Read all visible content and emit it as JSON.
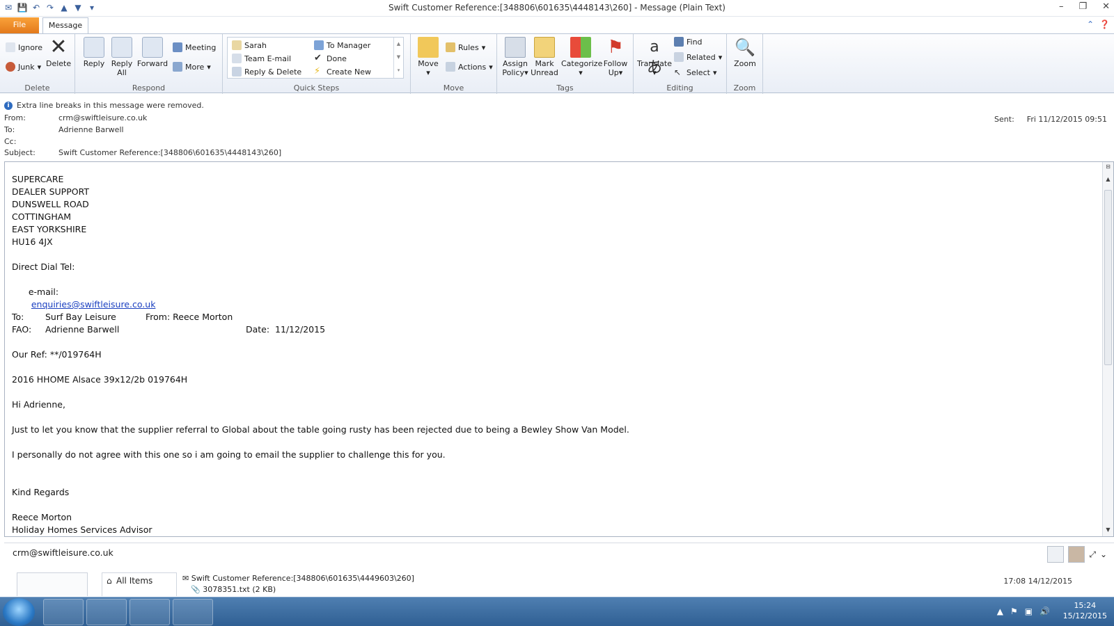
{
  "window": {
    "title": "Swift Customer Reference:[348806\\601635\\4448143\\260]  - Message (Plain Text)"
  },
  "tabs": {
    "file": "File",
    "message": "Message"
  },
  "ribbon": {
    "delete_group": {
      "label": "Delete",
      "ignore": "Ignore",
      "junk": "Junk",
      "delete": "Delete"
    },
    "respond_group": {
      "label": "Respond",
      "reply": "Reply",
      "reply_all_1": "Reply",
      "reply_all_2": "All",
      "forward": "Forward",
      "meeting": "Meeting",
      "more": "More"
    },
    "quick_steps": {
      "label": "Quick Steps",
      "sarah": "Sarah",
      "team_email": "Team E-mail",
      "reply_delete": "Reply & Delete",
      "to_manager": "To Manager",
      "done": "Done",
      "create_new": "Create New"
    },
    "move_group": {
      "label": "Move",
      "move": "Move",
      "rules": "Rules",
      "actions": "Actions"
    },
    "tags_group": {
      "label": "Tags",
      "assign_1": "Assign",
      "assign_2": "Policy",
      "mark_1": "Mark",
      "mark_2": "Unread",
      "categorize": "Categorize",
      "follow_1": "Follow",
      "follow_2": "Up"
    },
    "editing_group": {
      "label": "Editing",
      "translate": "Translate",
      "find": "Find",
      "related": "Related",
      "select": "Select"
    },
    "zoom_group": {
      "label": "Zoom",
      "zoom": "Zoom"
    }
  },
  "header": {
    "info": "Extra line breaks in this message were removed.",
    "from_label": "From:",
    "from": "crm@swiftleisure.co.uk",
    "to_label": "To:",
    "to": "Adrienne Barwell",
    "cc_label": "Cc:",
    "subject_label": "Subject:",
    "subject": "Swift Customer Reference:[348806\\601635\\4448143\\260]",
    "sent_label": "Sent:",
    "sent": "Fri 11/12/2015 09:51"
  },
  "body": {
    "l1": "SUPERCARE",
    "l2": "DEALER SUPPORT",
    "l3": "DUNSWELL ROAD",
    "l4": "COTTINGHAM",
    "l5": "EAST YORKSHIRE",
    "l6": "HU16 4JX",
    "direct": "Direct Dial Tel:",
    "email_label": "e-mail:",
    "email": "enquiries@swiftleisure.co.uk",
    "to_label": "To:",
    "to_val": "Surf Bay Leisure",
    "from_label": "From: Reece Morton",
    "fao_label": "FAO:",
    "fao_val": "Adrienne Barwell",
    "date_label": "Date:",
    "date_val": "11/12/2015",
    "ref": "Our Ref: **/019764H",
    "model": "2016 HHOME Alsace 39x12/2b 019764H",
    "greeting": "Hi Adrienne,",
    "p1": "Just to let you know that the supplier referral to Global about the table going rusty has been rejected due to being a Bewley Show Van Model.",
    "p2": "I personally do not agree with this one so i am going to email the supplier to challenge this for you.",
    "regards": "Kind Regards",
    "name": "Reece Morton",
    "role": "Holiday Homes Services Advisor"
  },
  "people_pane": {
    "email": "crm@swiftleisure.co.uk",
    "all_items": "All Items",
    "item_subject": "Swift Customer Reference:[348806\\601635\\4449603\\260]",
    "item_attachment": "3078351.txt (2 KB)",
    "item_date": "17:08 14/12/2015"
  },
  "taskbar": {
    "time": "15:24",
    "date": "15/12/2015"
  }
}
